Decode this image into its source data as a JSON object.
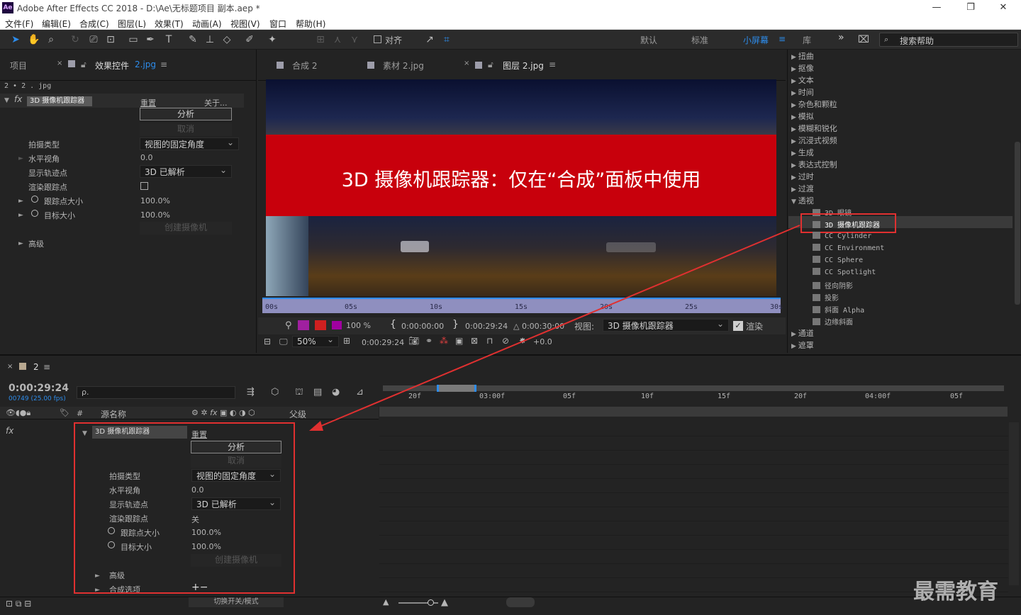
{
  "window": {
    "title": "Adobe After Effects CC 2018 - D:\\Ae\\无标题项目 副本.aep *",
    "logo": "Ae",
    "controls": [
      "—",
      "❐",
      "✕"
    ]
  },
  "menu": [
    "文件(F)",
    "编辑(E)",
    "合成(C)",
    "图层(L)",
    "效果(T)",
    "动画(A)",
    "视图(V)",
    "窗口",
    "帮助(H)"
  ],
  "toolbar": {
    "snap_label": "对齐",
    "workspaces": [
      "默认",
      "标准",
      "小屏幕",
      "库"
    ],
    "active_workspace": "小屏幕",
    "menu_icon": "≡",
    "overflow": "»",
    "search_placeholder": "搜索帮助"
  },
  "left_panel": {
    "tab_project": "项目",
    "tab_effects": "效果控件",
    "tab_effects_target": "2.jpg",
    "breadcrumb": "2 • 2 . jpg",
    "fx_label": "fx",
    "effect_name": "3D 摄像机跟踪器",
    "reset": "重置",
    "about": "关于...",
    "analyze": "分析",
    "cancel": "取消",
    "shot_type_label": "拍摄类型",
    "shot_type_value": "视图的固定角度",
    "fov_label": "水平视角",
    "fov_value": "0.0",
    "show_track_label": "显示轨迹点",
    "show_track_value": "3D 已解析",
    "render_track_label": "渲染跟踪点",
    "track_size_label": "跟踪点大小",
    "track_size_value": "100.0%",
    "target_size_label": "目标大小",
    "target_size_value": "100.0%",
    "create_camera": "创建摄像机",
    "advanced": "高级"
  },
  "viewer": {
    "tabs": [
      "合成 2",
      "素材 2.jpg",
      "图层 2.jpg"
    ],
    "active_tab": "图层 2.jpg",
    "overlay_text": "3D 摄像机跟踪器：仅在“合成”面板中使用",
    "ruler_ticks": [
      "00s",
      "05s",
      "10s",
      "15s",
      "20s",
      "25s",
      "30s"
    ],
    "opacity": "100 %",
    "time_in": "0:00:00:00",
    "time_out": "0:00:29:24",
    "duration": "△ 0:00:30:00",
    "view_label": "视图:",
    "view_value": "3D 摄像机跟踪器",
    "render_label": "渲染",
    "zoom": "50%",
    "current_time": "0:00:29:24",
    "exposure": "+0.0"
  },
  "effects_panel": {
    "categories_top": [
      "扭曲",
      "抠像",
      "文本",
      "时间",
      "杂色和颗粒",
      "模拟",
      "模糊和锐化",
      "沉浸式视频",
      "生成",
      "表达式控制",
      "过时",
      "过渡",
      "透视"
    ],
    "perspective_items": [
      "3D 眼镜",
      "3D 摄像机跟踪器",
      "CC Cylinder",
      "CC Environment",
      "CC Sphere",
      "CC Spotlight",
      "径向阴影",
      "投影",
      "斜面 Alpha",
      "边缘斜面"
    ],
    "selected_item": "3D 摄像机跟踪器",
    "categories_bottom": [
      "通道",
      "遮罩"
    ]
  },
  "timeline": {
    "comp_tab": "2",
    "timecode": "0:00:29:24",
    "frame_info": "00749 (25.00 fps)",
    "search_placeholder": "ρ.",
    "col_source": "源名称",
    "col_parent": "父级",
    "col_num": "#",
    "fx_label": "fx",
    "ruler_ticks": [
      "20f",
      "03:00f",
      "05f",
      "10f",
      "15f",
      "20f",
      "04:00f",
      "05f"
    ],
    "effect_name": "3D 摄像机跟踪器",
    "reset": "重置",
    "analyze": "分析",
    "cancel": "取消",
    "shot_type_label": "拍摄类型",
    "shot_type_value": "视图的固定角度",
    "fov_label": "水平视角",
    "fov_value": "0.0",
    "show_track_label": "显示轨迹点",
    "show_track_value": "3D 已解析",
    "render_track_label": "渲染跟踪点",
    "render_track_value": "关",
    "track_size_label": "跟踪点大小",
    "track_size_value": "100.0%",
    "target_size_label": "目标大小",
    "target_size_value": "100.0%",
    "create_camera": "创建摄像机",
    "advanced": "高级",
    "comp_options": "合成选项",
    "comp_options_controls": "+−",
    "toggle_label": "切换开关/模式"
  },
  "watermark": "最需教育",
  "colors": {
    "accent": "#2d8ceb",
    "highlight_red": "#e03030",
    "banner_red": "#c8000c",
    "panel_bg": "#232323"
  }
}
